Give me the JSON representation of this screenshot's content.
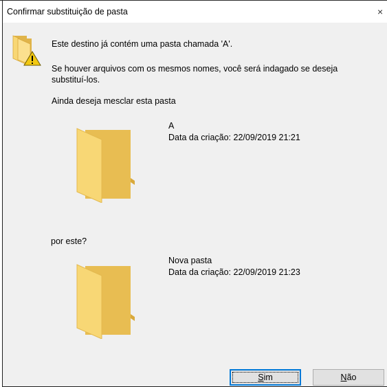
{
  "window": {
    "title": "Confirmar substituição de pasta",
    "close_glyph": "×"
  },
  "message": {
    "line1": "Este destino já contém uma pasta chamada 'A'.",
    "line2a": "Se houver arquivos com os mesmos nomes, você será indagado se deseja",
    "line2b": "substituí-los.",
    "line3": "Ainda deseja mesclar esta pasta"
  },
  "existing_folder": {
    "name": "A",
    "created": "Data da criação: 22/09/2019 21:21"
  },
  "question": "por este?",
  "new_folder": {
    "name": "Nova pasta",
    "created": "Data da criação: 22/09/2019 21:23"
  },
  "buttons": {
    "yes_mnemonic": "S",
    "yes_rest": "im",
    "no_mnemonic": "N",
    "no_rest": "ão"
  },
  "icons": {
    "header": "folder-warning-icon",
    "existing": "folder-icon",
    "new": "folder-icon"
  },
  "colors": {
    "dialog_bg": "#f0f0f0",
    "folder_front": "#f8d775",
    "folder_back": "#e0b44a",
    "warning": "#f2c811",
    "default_button_border": "#0078d7"
  }
}
